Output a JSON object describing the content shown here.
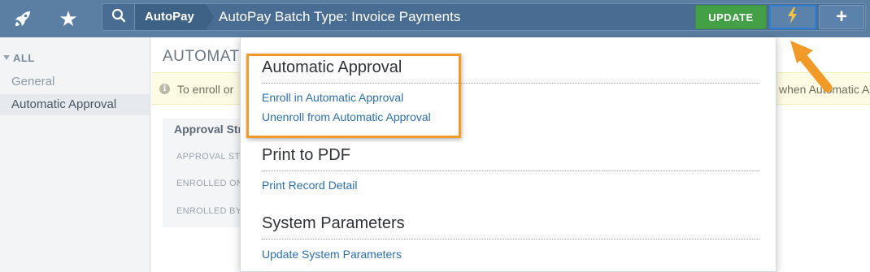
{
  "topbar": {
    "rocket_icon": "rocket-icon",
    "star_icon": "star-icon",
    "search_icon": "search-icon",
    "app_name": "AutoPay",
    "record_title": "AutoPay Batch Type: Invoice Payments",
    "update_label": "UPDATE",
    "bolt_icon": "lightning-bolt-icon",
    "plus_icon": "plus-icon"
  },
  "sidebar": {
    "all_label": "ALL",
    "items": [
      {
        "label": "General"
      },
      {
        "label": "Automatic Approval"
      }
    ]
  },
  "main": {
    "section_title": "AUTOMATI",
    "info_text_left": "To enroll or",
    "info_text_right": "when Automatic A",
    "panel": {
      "heading": "Approval Str",
      "labels": [
        "APPROVAL STR",
        "ENROLLED ON",
        "ENROLLED BY"
      ]
    }
  },
  "dropdown": {
    "sections": [
      {
        "heading": "Automatic Approval",
        "links": [
          "Enroll in Automatic Approval",
          "Unenroll from Automatic Approval"
        ]
      },
      {
        "heading": "Print to PDF",
        "links": [
          "Print Record Detail"
        ]
      },
      {
        "heading": "System Parameters",
        "links": [
          "Update System Parameters"
        ]
      }
    ]
  },
  "colors": {
    "topbar": "#5b7fa3",
    "update_green": "#43a047",
    "link_blue": "#2b6fb0",
    "highlight_orange": "#f29a27",
    "bolt_yellow": "#f5c242"
  }
}
